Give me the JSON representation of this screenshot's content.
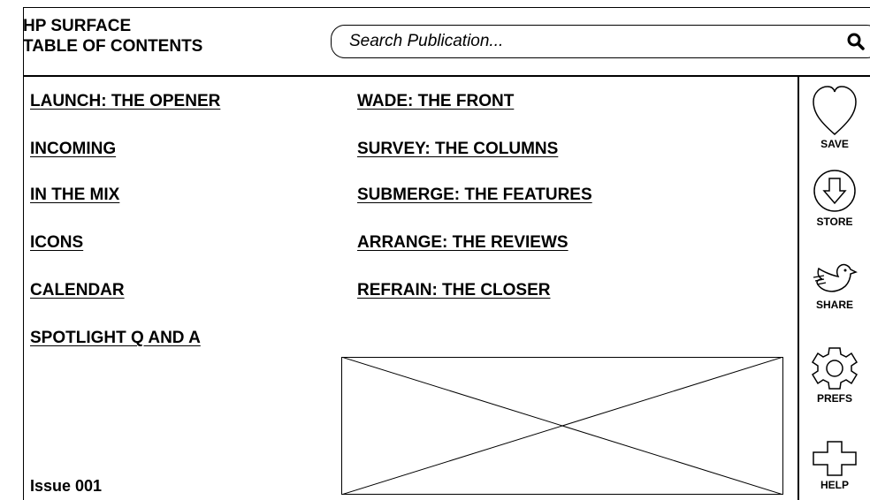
{
  "header": {
    "title_line1": "HP SURFACE",
    "title_line2": "TABLE OF CONTENTS"
  },
  "search": {
    "placeholder": "Search Publication...",
    "icon": "search-icon"
  },
  "toc": {
    "left_column": [
      "LAUNCH: THE OPENER",
      "INCOMING",
      "IN THE MIX",
      "ICONS",
      "CALENDAR",
      "SPOTLIGHT Q AND A"
    ],
    "right_column": [
      "WADE: THE FRONT",
      "SURVEY: THE COLUMNS",
      "SUBMERGE: THE FEATURES",
      "ARRANGE: THE REVIEWS",
      "REFRAIN: THE CLOSER"
    ]
  },
  "footer": {
    "issue": "Issue 001"
  },
  "sidebar": {
    "buttons": [
      {
        "label": "SAVE",
        "icon": "heart-icon"
      },
      {
        "label": "STORE",
        "icon": "download-icon"
      },
      {
        "label": "SHARE",
        "icon": "bird-icon"
      },
      {
        "label": "PREFS",
        "icon": "gear-icon"
      },
      {
        "label": "HELP",
        "icon": "plus-icon"
      }
    ]
  }
}
